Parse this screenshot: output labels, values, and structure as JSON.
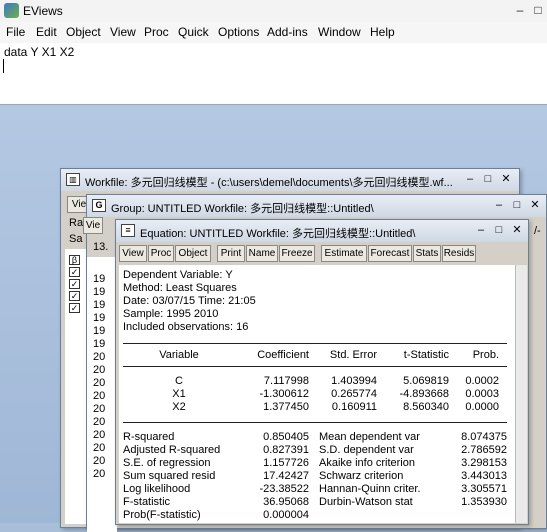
{
  "app": {
    "title": "EViews",
    "window_controls": [
      "–",
      "□"
    ]
  },
  "menu": [
    "File",
    "Edit",
    "Object",
    "View",
    "Proc",
    "Quick",
    "Options",
    "Add-ins",
    "Window",
    "Help"
  ],
  "command": {
    "text": "data  Y X1 X2"
  },
  "workfile": {
    "title": "Workfile: 多元回归线模型 - (c:\\users\\demel\\documents\\多元回归线模型.wf...",
    "buttons": [
      "Vie"
    ],
    "labels": [
      "Ra",
      "Sa"
    ],
    "range_text": "13.",
    "row_prefix": [
      "19",
      "19",
      "19",
      "19",
      "19",
      "19",
      "20",
      "20",
      "20",
      "20",
      "20",
      "20",
      "20",
      "20",
      "20",
      "20"
    ],
    "controls": [
      "–",
      "□",
      "✕"
    ]
  },
  "group": {
    "title": "Group: UNTITLED   Workfile: 多元回归线模型::Untitled\\",
    "icon": "G",
    "buttons": [
      "Vie"
    ],
    "controls": [
      "–",
      "□",
      "✕"
    ],
    "right_marker": "/-"
  },
  "equation": {
    "title": "Equation: UNTITLED   Workfile: 多元回归线模型::Untitled\\",
    "controls": [
      "–",
      "□",
      "✕"
    ],
    "toolbar": [
      "View",
      "Proc",
      "Object",
      "Print",
      "Name",
      "Freeze",
      "Estimate",
      "Forecast",
      "Stats",
      "Resids"
    ],
    "header": [
      "Dependent Variable: Y",
      "Method: Least Squares",
      "Date: 03/07/15   Time: 21:05",
      "Sample: 1995 2010",
      "Included observations: 16"
    ],
    "columns": [
      "Variable",
      "Coefficient",
      "Std. Error",
      "t-Statistic",
      "Prob."
    ],
    "rows": [
      {
        "var": "C",
        "coef": "7.117998",
        "se": "1.403994",
        "t": "5.069819",
        "p": "0.0002"
      },
      {
        "var": "X1",
        "coef": "-1.300612",
        "se": "0.265774",
        "t": "-4.893668",
        "p": "0.0003"
      },
      {
        "var": "X2",
        "coef": "1.377450",
        "se": "0.160911",
        "t": "8.560340",
        "p": "0.0000"
      }
    ],
    "stats_left": [
      {
        "label": "R-squared",
        "value": "0.850405"
      },
      {
        "label": "Adjusted R-squared",
        "value": "0.827391"
      },
      {
        "label": "S.E. of regression",
        "value": "1.157726"
      },
      {
        "label": "Sum squared resid",
        "value": "17.42427"
      },
      {
        "label": "Log likelihood",
        "value": "-23.38522"
      },
      {
        "label": "F-statistic",
        "value": "36.95068"
      },
      {
        "label": "Prob(F-statistic)",
        "value": "0.000004"
      }
    ],
    "stats_right": [
      {
        "label": "Mean dependent var",
        "value": "8.074375"
      },
      {
        "label": "S.D. dependent var",
        "value": "2.786592"
      },
      {
        "label": "Akaike info criterion",
        "value": "3.298153"
      },
      {
        "label": "Schwarz criterion",
        "value": "3.443013"
      },
      {
        "label": "Hannan-Quinn criter.",
        "value": "3.305571"
      },
      {
        "label": "Durbin-Watson stat",
        "value": "1.353930"
      }
    ]
  }
}
